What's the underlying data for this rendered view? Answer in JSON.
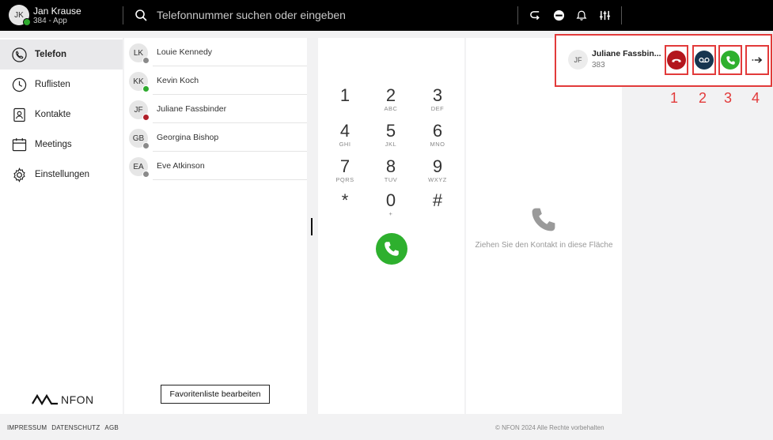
{
  "user": {
    "initials": "JK",
    "name": "Jan Krause",
    "extension": "384 - App"
  },
  "search": {
    "placeholder": "Telefonnummer suchen oder eingeben"
  },
  "topbar_icons": [
    "callback-icon",
    "do-not-disturb-icon",
    "bell-icon",
    "sliders-icon"
  ],
  "sidebar": {
    "items": [
      {
        "label": "Telefon",
        "icon": "phone-icon",
        "active": true
      },
      {
        "label": "Ruflisten",
        "icon": "clock-icon",
        "active": false
      },
      {
        "label": "Kontakte",
        "icon": "contacts-icon",
        "active": false
      },
      {
        "label": "Meetings",
        "icon": "calendar-icon",
        "active": false
      },
      {
        "label": "Einstellungen",
        "icon": "gear-icon",
        "active": false
      }
    ],
    "logo_text": "NFON"
  },
  "favorites": {
    "items": [
      {
        "initials": "LK",
        "name": "Louie Kennedy",
        "status_color": "#8a8a8a"
      },
      {
        "initials": "KK",
        "name": "Kevin Koch",
        "status_color": "#2eaa2e"
      },
      {
        "initials": "JF",
        "name": "Juliane Fassbinder",
        "status_color": "#b0202a"
      },
      {
        "initials": "GB",
        "name": "Georgina Bishop",
        "status_color": "#8a8a8a"
      },
      {
        "initials": "EA",
        "name": "Eve Atkinson",
        "status_color": "#8a8a8a"
      }
    ],
    "edit_button": "Favoritenliste bearbeiten"
  },
  "dialpad": {
    "keys": [
      {
        "digit": "1",
        "letters": ""
      },
      {
        "digit": "2",
        "letters": "ABC"
      },
      {
        "digit": "3",
        "letters": "DEF"
      },
      {
        "digit": "4",
        "letters": "GHI"
      },
      {
        "digit": "5",
        "letters": "JKL"
      },
      {
        "digit": "6",
        "letters": "MNO"
      },
      {
        "digit": "7",
        "letters": "PQRS"
      },
      {
        "digit": "8",
        "letters": "TUV"
      },
      {
        "digit": "9",
        "letters": "WXYZ"
      },
      {
        "digit": "*",
        "letters": ""
      },
      {
        "digit": "0",
        "letters": "+"
      },
      {
        "digit": "#",
        "letters": ""
      }
    ]
  },
  "droparea": {
    "text": "Ziehen Sie den Kontakt in diese Fläche"
  },
  "incoming_call": {
    "initials": "JF",
    "name": "Juliane Fassbin...",
    "extension": "383",
    "buttons": [
      {
        "name": "reject-call",
        "color": "#b3161d",
        "label": "1"
      },
      {
        "name": "voicemail",
        "color": "#17354f",
        "label": "2"
      },
      {
        "name": "accept-call",
        "color": "#2eb02e",
        "label": "3"
      },
      {
        "name": "forward",
        "color": "#ffffff",
        "label": "4"
      }
    ]
  },
  "footer": {
    "links": [
      "IMPRESSUM",
      "DATENSCHUTZ",
      "AGB"
    ],
    "copyright": "© NFON 2024 Alle Rechte vorbehalten"
  }
}
